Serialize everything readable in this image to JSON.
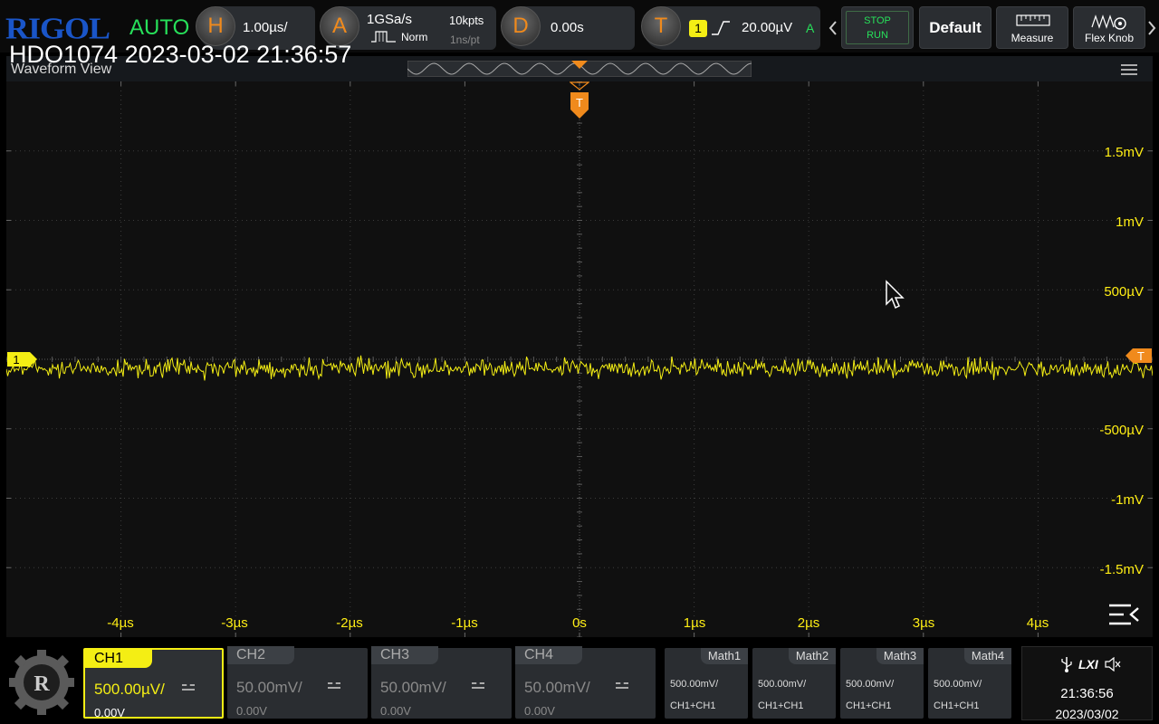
{
  "brand": "RIGOL",
  "trigger_mode": "AUTO",
  "screenshot_stamp": "HDO1074 2023-03-02 21:36:57",
  "horizontal": {
    "key": "H",
    "scale": "1.00µs/"
  },
  "acquire": {
    "key": "A",
    "sample_rate": "1GSa/s",
    "memory_depth": "10kpts",
    "acq_mode": "Norm",
    "sample_period": "1ns/pt"
  },
  "delay": {
    "key": "D",
    "value": "0.00s"
  },
  "trigger": {
    "key": "T",
    "source": "1",
    "level": "20.00µV",
    "coupling": "A"
  },
  "buttons": {
    "stop": "STOP",
    "run": "RUN",
    "default": "Default",
    "measure": "Measure",
    "flex_knob": "Flex Knob"
  },
  "waveform_view": {
    "title": "Waveform View",
    "y_labels": [
      "1.5mV",
      "1mV",
      "500µV",
      "-500µV",
      "-1mV",
      "-1.5mV"
    ],
    "x_labels": [
      "-4µs",
      "-3µs",
      "-2µs",
      "-1µs",
      "0s",
      "1µs",
      "2µs",
      "3µs",
      "4µs"
    ],
    "ch1_marker": "1",
    "trigger_marker": "T"
  },
  "channels": [
    {
      "name": "CH1",
      "scale": "500.00µV/",
      "offset": "0.00V",
      "active": true
    },
    {
      "name": "CH2",
      "scale": "50.00mV/",
      "offset": "0.00V",
      "active": false
    },
    {
      "name": "CH3",
      "scale": "50.00mV/",
      "offset": "0.00V",
      "active": false
    },
    {
      "name": "CH4",
      "scale": "50.00mV/",
      "offset": "0.00V",
      "active": false
    }
  ],
  "math": [
    {
      "name": "Math1",
      "scale": "500.00mV/",
      "expr": "CH1+CH1"
    },
    {
      "name": "Math2",
      "scale": "500.00mV/",
      "expr": "CH1+CH1"
    },
    {
      "name": "Math3",
      "scale": "500.00mV/",
      "expr": "CH1+CH1"
    },
    {
      "name": "Math4",
      "scale": "500.00mV/",
      "expr": "CH1+CH1"
    }
  ],
  "status": {
    "lxi": "LXI",
    "time": "21:36:56",
    "date": "2023/03/02"
  },
  "colors": {
    "ch1": "#f4ee14",
    "trigger": "#f08a1c",
    "brand": "#1a55c8",
    "auto": "#27e05a"
  }
}
